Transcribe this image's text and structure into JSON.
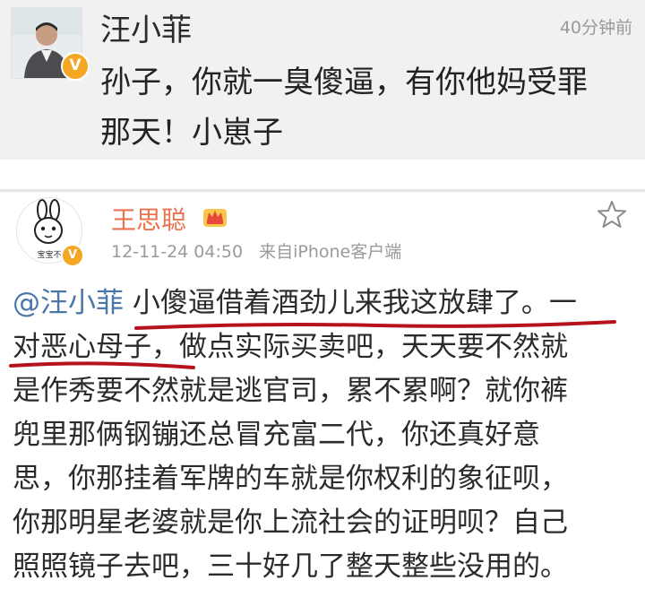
{
  "post1": {
    "author": "汪小菲",
    "time": "40分钟前",
    "lines": [
      "孙子，你就一臭傻逼，有你他妈受罪",
      "那天！小崽子"
    ]
  },
  "post2": {
    "author": "王思聪",
    "date": "12-11-24 04:50",
    "source": "来自iPhone客户端",
    "avatar_caption": "宝宝不",
    "mention": "@汪小菲",
    "line1_rest": " 小傻逼借着酒劲儿来我这放肆了。一",
    "lines": [
      "对恶心母子，做点实际买卖吧，天天要不然就",
      "是作秀要不然就是逃官司，累不累啊？就你裤",
      "兜里那俩钢镚还总冒充富二代，你还真好意",
      "思，你那挂着军牌的车就是你权利的象征呗，",
      "你那明星老婆就是你上流社会的证明呗？自己",
      "照照镜子去吧，三十好几了整天整些没用的。"
    ]
  },
  "colors": {
    "author_orange": "#eb7350",
    "mention_blue": "#4a76a8",
    "verified_gold": "#f5a623",
    "underline_red": "#b5121b"
  },
  "icons": [
    "verified-v-icon",
    "crown-icon",
    "star-icon"
  ]
}
